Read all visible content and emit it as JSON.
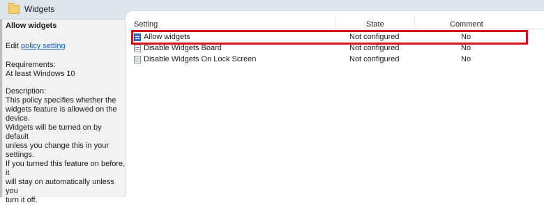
{
  "window": {
    "title": "Widgets"
  },
  "left_pane": {
    "heading": "Allow widgets",
    "edit_prefix": "Edit ",
    "edit_link": "policy setting",
    "requirements_label": "Requirements:",
    "requirements_value": "At least Windows 10",
    "description_label": "Description:",
    "description_lines": [
      "This policy specifies whether the\nwidgets feature is allowed on the\ndevice.",
      "Widgets will be turned on by default\nunless you change this in your\nsettings.",
      "If you turned this feature on before, it\nwill stay on automatically unless you\nturn it off."
    ]
  },
  "table": {
    "columns": {
      "setting": "Setting",
      "state": "State",
      "comment": "Comment"
    },
    "rows": [
      {
        "setting": "Allow widgets",
        "state": "Not configured",
        "comment": "No",
        "selected": true
      },
      {
        "setting": "Disable Widgets Board",
        "state": "Not configured",
        "comment": "No",
        "selected": false
      },
      {
        "setting": "Disable Widgets On Lock Screen",
        "state": "Not configured",
        "comment": "No",
        "selected": false
      }
    ]
  },
  "icons": {
    "titlebar": "folder-icon",
    "row": "policy-setting-icon"
  },
  "colors": {
    "highlight": "#d2111b",
    "link": "#0b62c4",
    "titlebar": "#dfe5ec"
  }
}
